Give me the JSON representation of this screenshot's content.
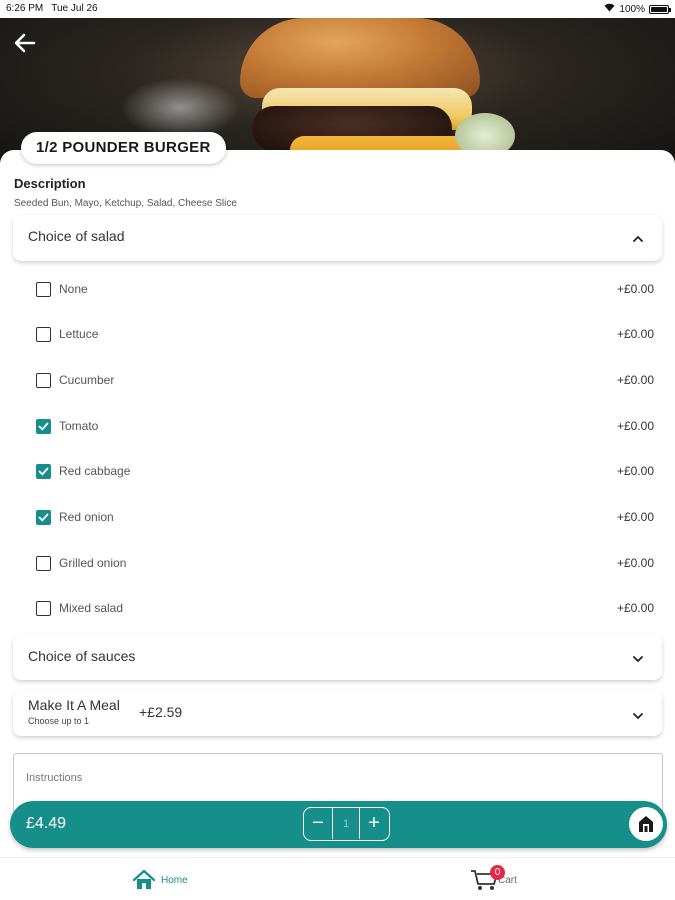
{
  "status_bar": {
    "time": "6:26 PM",
    "date": "Tue Jul 26",
    "battery": "100%"
  },
  "product": {
    "title": "1/2 POUNDER BURGER",
    "description_heading": "Description",
    "description": "Seeded Bun, Mayo, Ketchup, Salad, Cheese Slice"
  },
  "salad_group": {
    "label": "Choice of salad",
    "expanded": true,
    "options": [
      {
        "name": "None",
        "price": "+£0.00",
        "checked": false
      },
      {
        "name": "Lettuce",
        "price": "+£0.00",
        "checked": false
      },
      {
        "name": "Cucumber",
        "price": "+£0.00",
        "checked": false
      },
      {
        "name": "Tomato",
        "price": "+£0.00",
        "checked": true
      },
      {
        "name": "Red cabbage",
        "price": "+£0.00",
        "checked": true
      },
      {
        "name": "Red onion",
        "price": "+£0.00",
        "checked": true
      },
      {
        "name": "Grilled onion",
        "price": "+£0.00",
        "checked": false
      },
      {
        "name": "Mixed salad",
        "price": "+£0.00",
        "checked": false
      }
    ]
  },
  "sauces_group": {
    "label": "Choice of sauces",
    "expanded": false
  },
  "meal_group": {
    "label": "Make It A Meal",
    "sublabel": "Choose up to 1",
    "price": "+£2.59",
    "expanded": false
  },
  "instructions": {
    "placeholder": "Instructions",
    "value": ""
  },
  "cart_bar": {
    "total": "£4.49",
    "quantity": "1",
    "minus": "−",
    "plus": "+"
  },
  "bottom_nav": {
    "home_label": "Home",
    "cart_label": "Cart",
    "cart_count": "0"
  },
  "colors": {
    "accent": "#168f8b",
    "badge": "#e8264a"
  }
}
